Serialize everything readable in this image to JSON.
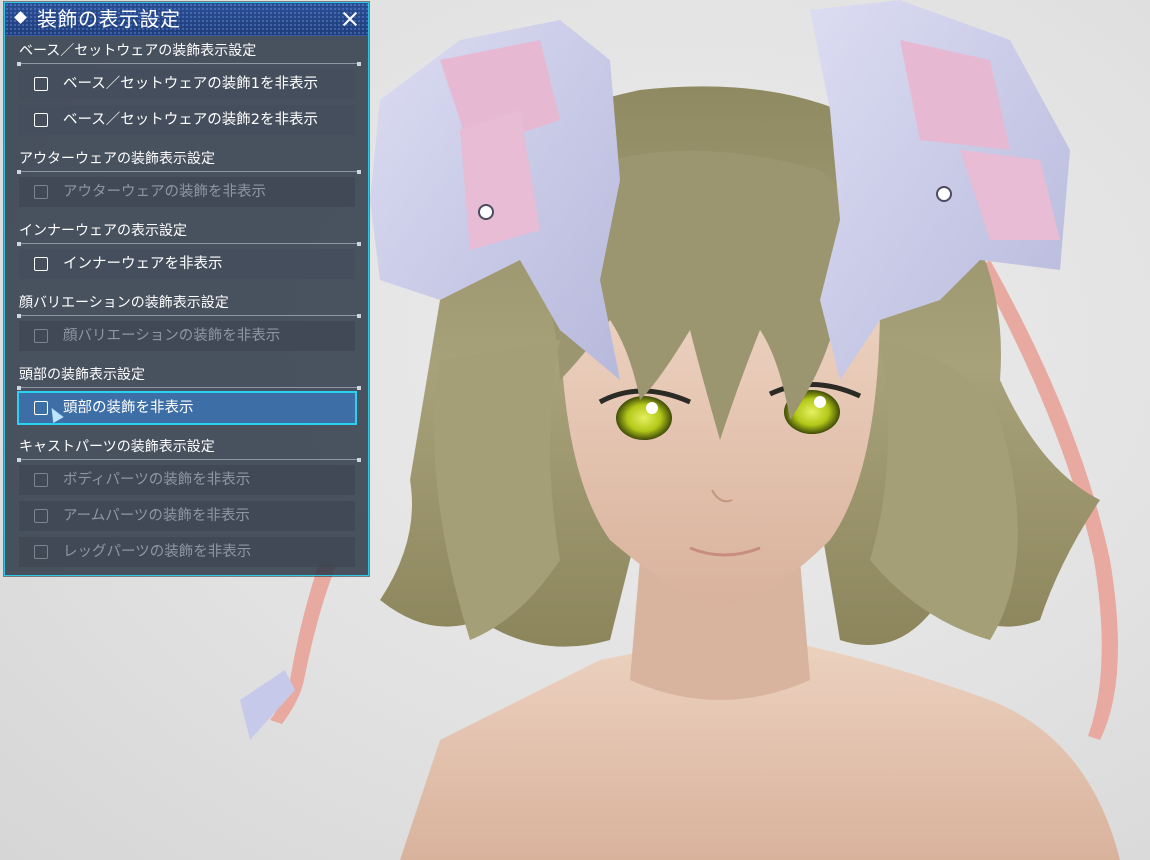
{
  "panel": {
    "title": "装飾の表示設定",
    "icons": {
      "title_marker": "diamond-icon",
      "close": "close-icon"
    },
    "colors": {
      "border": "#2ec7e6",
      "titlebar": "#1f3c78",
      "selected_row": "#3d6fa6",
      "disabled_text": "#8e96a2"
    },
    "sections": [
      {
        "header": "ベース／セットウェアの装飾表示設定",
        "options": [
          {
            "label": "ベース／セットウェアの装飾1を非表示",
            "checked": false,
            "enabled": true
          },
          {
            "label": "ベース／セットウェアの装飾2を非表示",
            "checked": false,
            "enabled": true
          }
        ]
      },
      {
        "header": "アウターウェアの装飾表示設定",
        "options": [
          {
            "label": "アウターウェアの装飾を非表示",
            "checked": false,
            "enabled": false
          }
        ]
      },
      {
        "header": "インナーウェアの表示設定",
        "options": [
          {
            "label": "インナーウェアを非表示",
            "checked": false,
            "enabled": true
          }
        ]
      },
      {
        "header": "顔バリエーションの装飾表示設定",
        "options": [
          {
            "label": "顔バリエーションの装飾を非表示",
            "checked": false,
            "enabled": false
          }
        ]
      },
      {
        "header": "頭部の装飾表示設定",
        "options": [
          {
            "label": "頭部の装飾を非表示",
            "checked": false,
            "enabled": true,
            "selected": true
          }
        ]
      },
      {
        "header": "キャストパーツの装飾表示設定",
        "options": [
          {
            "label": "ボディパーツの装飾を非表示",
            "checked": false,
            "enabled": false
          },
          {
            "label": "アームパーツの装飾を非表示",
            "checked": false,
            "enabled": false
          },
          {
            "label": "レッグパーツの装飾を非表示",
            "checked": false,
            "enabled": false
          }
        ]
      }
    ]
  },
  "scene": {
    "colors": {
      "background": "#e4e4e4",
      "hair": "#a09a72",
      "skin": "#e9c9b4",
      "headgear": "#c9cbe8",
      "headgear_accent": "#e4b7cf",
      "eye": "#b8d020"
    }
  }
}
